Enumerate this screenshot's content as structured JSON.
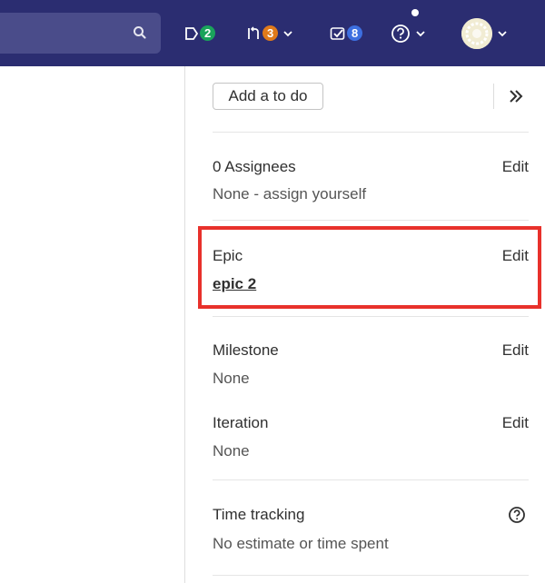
{
  "topbar": {
    "issues_count": "2",
    "merge_requests_count": "3",
    "todos_count": "8",
    "colors": {
      "bar": "#2b2d71",
      "issues_badge": "#1aa35b",
      "mr_badge": "#e07a1a",
      "todos_badge": "#3d6fe0"
    }
  },
  "sidebar": {
    "todo_button": "Add a to do",
    "assignees": {
      "title": "0 Assignees",
      "value": "None - assign yourself",
      "edit": "Edit"
    },
    "epic": {
      "title": "Epic",
      "value": "epic 2",
      "edit": "Edit"
    },
    "milestone": {
      "title": "Milestone",
      "value": "None",
      "edit": "Edit"
    },
    "iteration": {
      "title": "Iteration",
      "value": "None",
      "edit": "Edit"
    },
    "time_tracking": {
      "title": "Time tracking",
      "value": "No estimate or time spent"
    }
  },
  "highlight_color": "#e8312b"
}
